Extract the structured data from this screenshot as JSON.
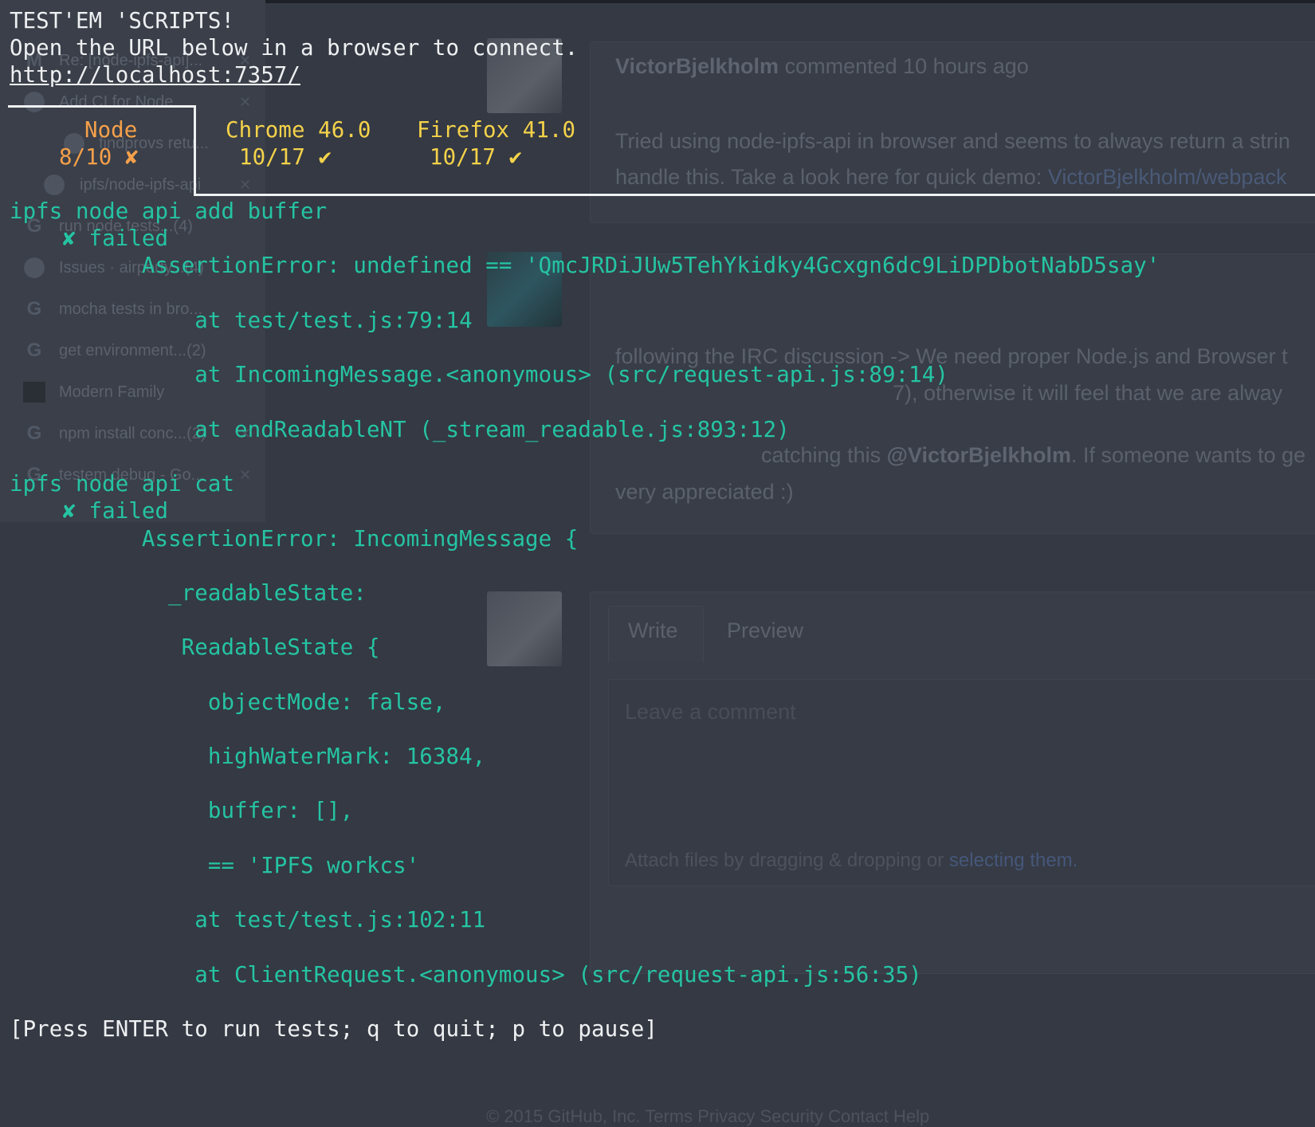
{
  "background": {
    "tabs": [
      {
        "label": "Re: [node-ipfs-api]...",
        "icon": "gmail-icon",
        "close": "✕"
      },
      {
        "label": "Add CI for Node....",
        "icon": "github-icon",
        "close": "✕"
      },
      {
        "label": "findprovs retu...",
        "icon": "github-icon",
        "close": "✕"
      },
      {
        "label": "ipfs/node-ipfs-api",
        "icon": "github-icon",
        "close": "✕"
      },
      {
        "label": "run node tests...(4)",
        "icon": "google-icon",
        "close": "✕"
      },
      {
        "label": "Issues · airporty...(4)",
        "icon": "github-icon",
        "close": "✕"
      },
      {
        "label": "mocha tests in bro...",
        "icon": "google-icon",
        "close": "✕"
      },
      {
        "label": "get environment...(2)",
        "icon": "google-icon",
        "close": "✕"
      },
      {
        "label": "Modern Family",
        "icon": "tv-icon",
        "close": "✕"
      },
      {
        "label": "npm install conc...(2)",
        "icon": "google-icon",
        "close": "✕"
      },
      {
        "label": "testem debug - Go...",
        "icon": "google-icon",
        "close": "✕"
      }
    ],
    "comment1": {
      "author": "VictorBjelkholm",
      "meta": "commented 10 hours ago",
      "line1": "Tried using node-ipfs-api in browser and seems to always return a strin",
      "line2_text": "handle this. Take a look here for quick demo: ",
      "line2_link": "VictorBjelkholm/webpack"
    },
    "comment2": {
      "line1": "following the IRC discussion -> We need proper Node.js and Browser t",
      "line2": "7), otherwise it will feel that we are alway",
      "line3_pre": "catching this ",
      "line3_mention": "@VictorBjelkholm",
      "line3_post": ". If someone wants to ge",
      "line4": "very appreciated :)"
    },
    "editor": {
      "tab_write": "Write",
      "tab_preview": "Preview",
      "placeholder": "Leave a comment",
      "attach_text": "Attach files by dragging & dropping or ",
      "attach_link": "selecting them."
    },
    "footer": "© 2015 GitHub, Inc.  Terms  Privacy  Security  Contact  Help"
  },
  "terminal": {
    "title": "TEST'EM 'SCRIPTS!",
    "instruction": "Open the URL below in a browser to connect.",
    "url": "http://localhost:7357/",
    "launchers": [
      {
        "name": "Node",
        "result": "8/10 ✘",
        "status": "fail"
      },
      {
        "name": "Chrome 46.0",
        "result": "10/17 ✔",
        "status": "pass"
      },
      {
        "name": "Firefox 41.0",
        "result": "10/17 ✔",
        "status": "pass"
      }
    ],
    "lines": [
      "ipfs node api add buffer",
      "    ✘ failed",
      "          AssertionError: undefined == 'QmcJRDiJUw5TehYkidky4Gcxgn6dc9LiDPDbotNabD5say'",
      "              at test/test.js:79:14",
      "              at IncomingMessage.<anonymous> (src/request-api.js:89:14)",
      "              at endReadableNT (_stream_readable.js:893:12)",
      "ipfs node api cat",
      "    ✘ failed",
      "          AssertionError: IncomingMessage {",
      "            _readableState:",
      "             ReadableState {",
      "               objectMode: false,",
      "               highWaterMark: 16384,",
      "               buffer: [],",
      "               == 'IPFS workcs'",
      "              at test/test.js:102:11",
      "              at ClientRequest.<anonymous> (src/request-api.js:56:35)"
    ],
    "footer": "[Press ENTER to run tests; q to quit; p to pause]"
  },
  "colors": {
    "background": "#343943",
    "text": "#eef0f2",
    "green": "#25c4a3",
    "orange": "#f5a04a",
    "yellow": "#f4d24a"
  }
}
